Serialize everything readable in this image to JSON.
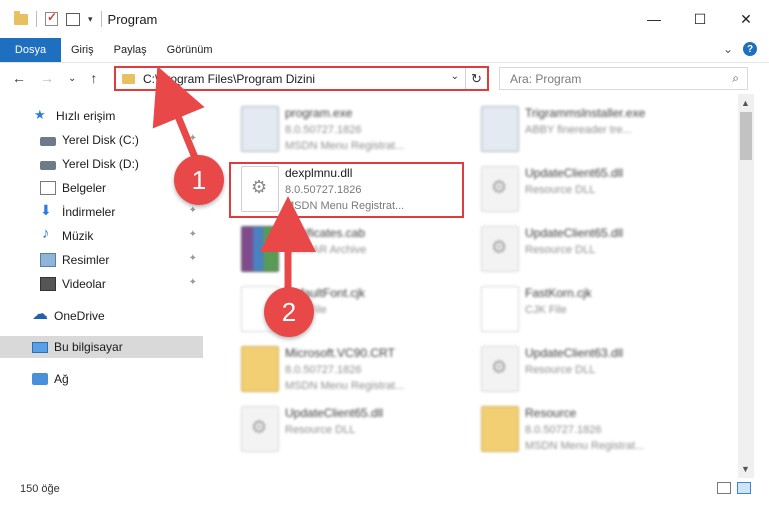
{
  "window": {
    "title": "Program",
    "min": "—",
    "max": "☐",
    "close": "✕"
  },
  "ribbon": {
    "tabs": [
      "Dosya",
      "Giriş",
      "Paylaş",
      "Görünüm"
    ],
    "expand": "⌄",
    "help": "?"
  },
  "nav": {
    "back": "←",
    "forward": "→",
    "recent": "⌄",
    "up": "↑"
  },
  "address": {
    "path": "C:\\Program Files\\Program Dizini",
    "dropdown": "⌄",
    "refresh": "↻"
  },
  "search": {
    "placeholder": "Ara: Program",
    "icon": "⌕"
  },
  "sidebar": {
    "items": [
      {
        "label": "Hızlı erişim",
        "icon": "star-icon"
      },
      {
        "label": "Yerel Disk (C:)",
        "icon": "disk-icon",
        "pinned": true
      },
      {
        "label": "Yerel Disk (D:)",
        "icon": "disk-icon",
        "pinned": true
      },
      {
        "label": "Belgeler",
        "icon": "documents-icon",
        "pinned": true
      },
      {
        "label": "İndirmeler",
        "icon": "downloads-icon",
        "pinned": true
      },
      {
        "label": "Müzik",
        "icon": "music-icon",
        "pinned": true
      },
      {
        "label": "Resimler",
        "icon": "pictures-icon",
        "pinned": true
      },
      {
        "label": "Videolar",
        "icon": "videos-icon",
        "pinned": true
      },
      {
        "label": "OneDrive",
        "icon": "cloud-icon"
      },
      {
        "label": "Bu bilgisayar",
        "icon": "computer-icon",
        "selected": true
      },
      {
        "label": "Ağ",
        "icon": "network-icon"
      }
    ],
    "pin_glyph": "📌"
  },
  "files": [
    {
      "name": "program.exe",
      "line1": "8.0.50727.1826",
      "line2": "MSDN Menu Registrat...",
      "kind": "exe"
    },
    {
      "name": "Trigrammslnstaller.exe",
      "line1": "ABBY finereader tre...",
      "line2": "",
      "kind": "exe"
    },
    {
      "name": "dexplmnu.dll",
      "line1": "8.0.50727.1826",
      "line2": "MSDN Menu Registrat...",
      "kind": "dll",
      "highlighted": true
    },
    {
      "name": "UpdateClient65.dll",
      "line1": "Resource DLL",
      "line2": "",
      "kind": "dll"
    },
    {
      "name": "certificates.cab",
      "line1": "WinRAR Archive",
      "line2": "",
      "kind": "rar"
    },
    {
      "name": "UpdateClient65.dll",
      "line1": "Resource DLL",
      "line2": "",
      "kind": "dll"
    },
    {
      "name": "DefaultFont.cjk",
      "line1": "CJK File",
      "line2": "",
      "kind": "doc"
    },
    {
      "name": "FastKorn.cjk",
      "line1": "CJK File",
      "line2": "",
      "kind": "doc"
    },
    {
      "name": "Microsoft.VC90.CRT",
      "line1": "8.0.50727.1826",
      "line2": "MSDN Menu Registrat...",
      "kind": "folder"
    },
    {
      "name": "UpdateClient63.dll",
      "line1": "Resource DLL",
      "line2": "",
      "kind": "dll"
    },
    {
      "name": "UpdateClient65.dll",
      "line1": "Resource DLL",
      "line2": "",
      "kind": "dll"
    },
    {
      "name": "Resource",
      "line1": "8.0.50727.1826",
      "line2": "MSDN Menu Registrat...",
      "kind": "folder"
    }
  ],
  "status": {
    "count": "150 öğe"
  },
  "callouts": {
    "one": "1",
    "two": "2"
  },
  "colors": {
    "accent": "#1e6fbf",
    "highlight": "#e03c3c",
    "callout": "#e84848"
  }
}
